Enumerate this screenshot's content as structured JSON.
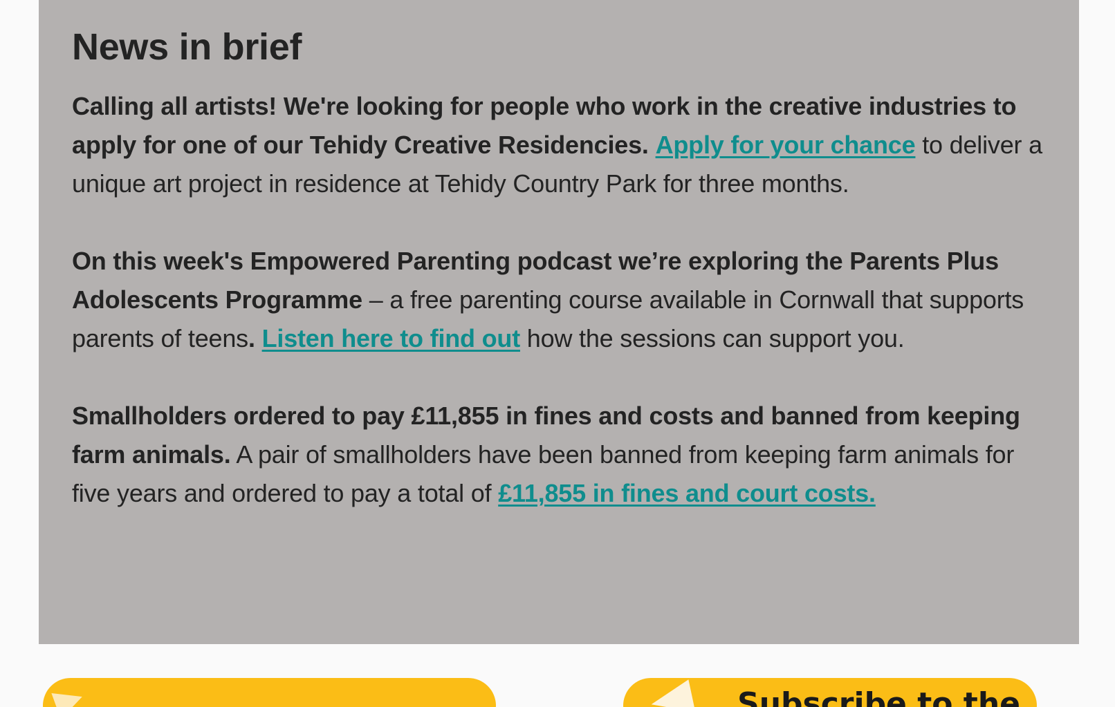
{
  "news": {
    "heading": "News in brief",
    "items": [
      {
        "bold": "Calling all artists! We're looking for people who work in the creative industries to apply for one of our Tehidy Creative Residencies.",
        "gap": " ",
        "link": "Apply for your chance",
        "after": " to deliver a unique art project in residence at Tehidy Country Park for three months."
      },
      {
        "bold": "On this week's Empowered Parenting podcast we’re exploring the Parents Plus Adolescents Programme",
        "mid": " – a free parenting course available in Cornwall that supports parents of teens",
        "dot": ".",
        "gap": "  ",
        "link": "Listen here to find out",
        "after": " how the sessions can support you."
      },
      {
        "bold": "Smallholders ordered to pay £11,855 in fines and costs and banned from keeping farm animals.",
        "mid": "  A pair of smallholders have been banned from keeping farm animals for five years and ordered to pay a total of ",
        "link": "£11,855 in fines and court costs."
      }
    ]
  },
  "banners": {
    "left_text": "",
    "right_text": "Subscribe to the"
  },
  "colors": {
    "panel_bg": "#b4b1b0",
    "link": "#0f8d8d",
    "text": "#232323",
    "banner": "#fbbd16"
  }
}
